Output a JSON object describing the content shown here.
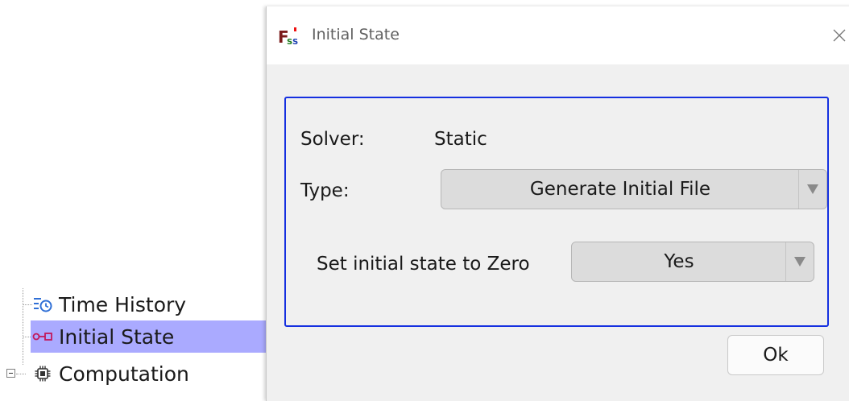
{
  "tree": {
    "items": [
      {
        "label": "Time History",
        "icon": "time-history-icon"
      },
      {
        "label": "Initial State",
        "icon": "initial-state-icon",
        "selected": true
      },
      {
        "label": "Computation",
        "icon": "chip-icon",
        "expander": "collapse"
      }
    ],
    "selected_color": "#aaaaff"
  },
  "dialog": {
    "title": "Initial State",
    "app_icon": "fss-logo-icon",
    "close_icon": "close-icon",
    "group": {
      "border_color": "#1530e0",
      "solver_label": "Solver:",
      "solver_value": "Static",
      "type_label": "Type:",
      "type_value": "Generate Initial File",
      "zero_label": "Set initial state to Zero",
      "zero_value": "Yes"
    },
    "ok_label": "Ok"
  }
}
